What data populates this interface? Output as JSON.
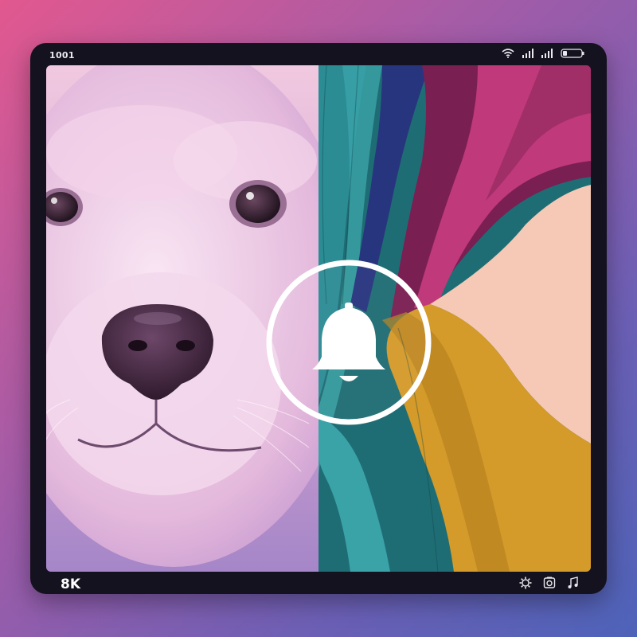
{
  "status_bar": {
    "time": "1001",
    "icons": [
      "wifi-icon",
      "signal-icon",
      "signal-icon",
      "battery-icon"
    ]
  },
  "content": {
    "left_image": "dog-portrait",
    "right_image": "abstract-waves",
    "overlay_icon": "bell-icon"
  },
  "bottom_bar": {
    "resolution_label": "8K",
    "icons": [
      "settings-icon",
      "camera-icon",
      "music-icon"
    ]
  },
  "colors": {
    "frame": "#14121e",
    "accent_magenta": "#c0397a",
    "accent_teal": "#2b8c94",
    "accent_gold": "#d49a2a",
    "accent_peach": "#f5c9b5"
  }
}
